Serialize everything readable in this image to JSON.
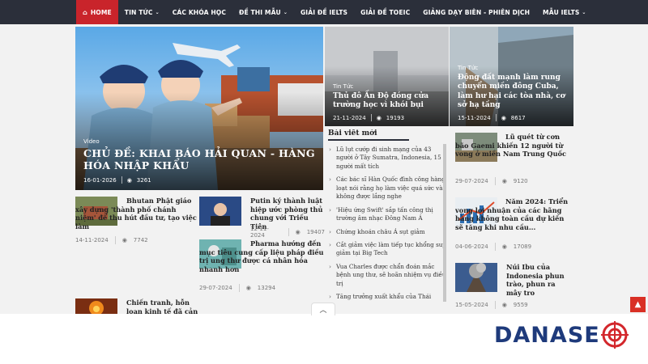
{
  "nav": {
    "home": "HOME",
    "items": [
      {
        "label": "TIN TỨC",
        "dropdown": true
      },
      {
        "label": "CÁC KHÓA HỌC",
        "dropdown": false
      },
      {
        "label": "ĐỀ THI MẪU",
        "dropdown": true
      },
      {
        "label": "GIẢI ĐỀ IELTS",
        "dropdown": false
      },
      {
        "label": "GIẢI ĐỀ TOEIC",
        "dropdown": false
      },
      {
        "label": "GIẢNG DẠY BIÊN - PHIÊN DỊCH",
        "dropdown": false
      },
      {
        "label": "MẪU IELTS",
        "dropdown": true
      }
    ]
  },
  "hero": {
    "category": "Video",
    "title": "CHỦ ĐỀ: KHAI BÁO HẢI QUAN - HÀNG HÓA NHẬP KHẨU",
    "date": "16-01-2026",
    "views": "3261"
  },
  "tiles": [
    {
      "category": "Tin Tức",
      "title": "Thủ đô Ấn Độ đóng cửa trường học vì khói bụi",
      "date": "21-11-2024",
      "views": "19193"
    },
    {
      "category": "Tin Tức",
      "title": "Động đất mạnh làm rung chuyển miền đông Cuba, làm hư hại các tòa nhà, cơ sở hạ tầng",
      "date": "15-11-2024",
      "views": "8617"
    }
  ],
  "grid": [
    {
      "title": "Bhutan Phật giáo xây dựng 'thành phố chánh niệm' để thu hút đầu tư, tạo việc làm",
      "date": "14-11-2024",
      "views": "7742"
    },
    {
      "title": "Putin ký thành luật hiệp ước phòng thủ chung với Triều Tiên",
      "date": "12-11-2024",
      "views": "19407"
    },
    {
      "title": "Pharma hướng đến mục tiêu cung cấp liệu pháp điều trị ung thư được cá nhân hóa nhanh hơn",
      "date": "29-07-2024",
      "views": "13294"
    },
    {
      "title": "Chiến tranh, hỗn loạn kinh tế đã cản trở nỗ",
      "date": "",
      "views": ""
    }
  ],
  "latest": {
    "heading": "Bài viết mới",
    "items": [
      "Lũ lụt cướp đi sinh mạng của 43 người ở Tây Sumatra, Indonesia, 15 người mất tích",
      "Các bác sĩ Hàn Quốc đình công hàng loạt nói rằng họ làm việc quá sức và không được lắng nghe",
      "'Hiệu ứng Swift' sắp tấn công thị trường âm nhạc Đông Nam Á",
      "Chứng khoán châu Á sụt giảm",
      "Cắt giảm việc làm tiếp tục khổng suy giảm tại Big Tech",
      "Vua Charles được chẩn đoán mắc bệnh ung thư, sẽ hoãn nhiệm vụ điều trị",
      "Tăng trưởng xuất khẩu của Thái"
    ]
  },
  "side": [
    {
      "title": "Lũ quét từ cơn bão Gaemi khiến 12 người từ vong ở miền Nam Trung Quốc",
      "date": "29-07-2024",
      "views": "9120"
    },
    {
      "title": "Năm 2024: Triển vọng lợi nhuận của các hãng hàng không toàn cầu dự kiến sẽ tăng khi nhu cầu...",
      "date": "04-06-2024",
      "views": "17089"
    },
    {
      "title": "Núi Ibu của Indonesia phun trào, phun ra mây tro",
      "date": "15-05-2024",
      "views": "9559"
    }
  ],
  "logo": {
    "text_a": "DANA",
    "text_b": "SE"
  },
  "colors": {
    "nav_bg": "#2b2f3a",
    "accent": "#c9242b",
    "logo_blue": "#1e3a7b",
    "logo_red": "#d3272c"
  }
}
